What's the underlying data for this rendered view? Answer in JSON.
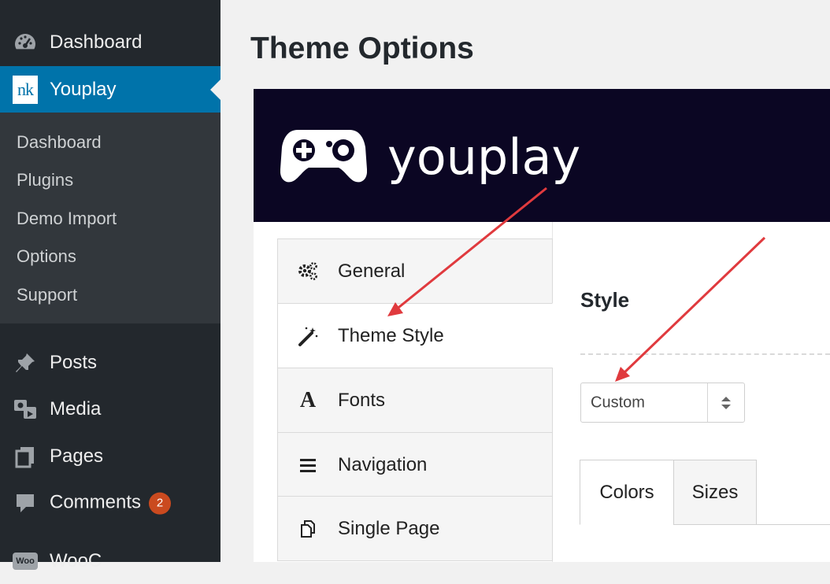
{
  "sidebar": {
    "dashboard_label": "Dashboard",
    "youplay_label": "Youplay",
    "youplay_logo_text": "nk",
    "submenu": [
      "Dashboard",
      "Plugins",
      "Demo Import",
      "Options",
      "Support"
    ],
    "posts_label": "Posts",
    "media_label": "Media",
    "pages_label": "Pages",
    "comments_label": "Comments",
    "comments_count": "2",
    "woo_label": "WooC",
    "woo_icon_text": "Woo"
  },
  "main": {
    "page_title": "Theme Options",
    "brand_name": "youplay",
    "vertical_tabs": [
      {
        "label": "General",
        "icon": "gears-icon"
      },
      {
        "label": "Theme Style",
        "icon": "magic-wand-icon"
      },
      {
        "label": "Fonts",
        "icon": "font-icon"
      },
      {
        "label": "Navigation",
        "icon": "list-icon"
      },
      {
        "label": "Single Page",
        "icon": "copy-icon"
      }
    ],
    "section_heading": "Style",
    "style_select_value": "Custom",
    "content_tabs": [
      "Colors",
      "Sizes"
    ]
  },
  "colors": {
    "sidebar_bg": "#23282d",
    "submenu_bg": "#32373c",
    "active_menu": "#0073aa",
    "brand_bar": "#0b0623",
    "badge": "#ca4a1f",
    "annotation_arrow": "#e03a3e"
  }
}
